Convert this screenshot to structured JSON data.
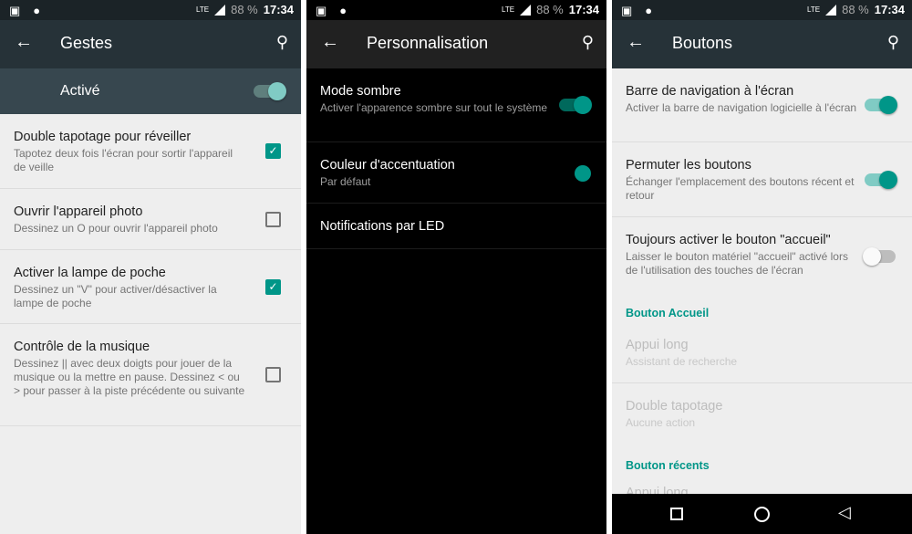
{
  "status": {
    "battery": "88 %",
    "time": "17:34",
    "network": "LTE"
  },
  "gestures": {
    "title": "Gestes",
    "master": "Activé",
    "master_on": true,
    "items": [
      {
        "title": "Double tapotage pour réveiller",
        "summary": "Tapotez deux fois l'écran pour sortir l'appareil de veille",
        "checked": true
      },
      {
        "title": "Ouvrir l'appareil photo",
        "summary": "Dessinez un O pour ouvrir l'appareil photo",
        "checked": false
      },
      {
        "title": "Activer la lampe de poche",
        "summary": "Dessinez un \"V\" pour activer/désactiver la lampe de poche",
        "checked": true
      },
      {
        "title": "Contrôle de la musique",
        "summary": "Dessinez || avec deux doigts pour jouer de la musique ou la mettre en pause. Dessinez < ou > pour passer à la piste précédente ou suivante",
        "checked": false
      }
    ]
  },
  "personalisation": {
    "title": "Personnalisation",
    "items": [
      {
        "title": "Mode sombre",
        "summary": "Activer l'apparence sombre sur tout le système",
        "on": true
      },
      {
        "title": "Couleur d'accentuation",
        "summary": "Par défaut",
        "color": "#009688"
      },
      {
        "title": "Notifications par LED"
      }
    ]
  },
  "buttons": {
    "title": "Boutons",
    "items": [
      {
        "title": "Barre de navigation à l'écran",
        "summary": "Activer la barre de navigation logicielle à l'écran",
        "on": true
      },
      {
        "title": "Permuter les boutons",
        "summary": "Échanger l'emplacement des boutons récent et retour",
        "on": true
      },
      {
        "title": "Toujours activer le bouton \"accueil\"",
        "summary": "Laisser le bouton matériel \"accueil\" activé lors de l'utilisation des touches de l'écran",
        "on": false
      }
    ],
    "home_header": "Bouton Accueil",
    "home_items": [
      {
        "title": "Appui long",
        "summary": "Assistant de recherche"
      },
      {
        "title": "Double tapotage",
        "summary": "Aucune action"
      }
    ],
    "recents_header": "Bouton récents",
    "recents_partial": "Appui long"
  },
  "accent": "#009688"
}
